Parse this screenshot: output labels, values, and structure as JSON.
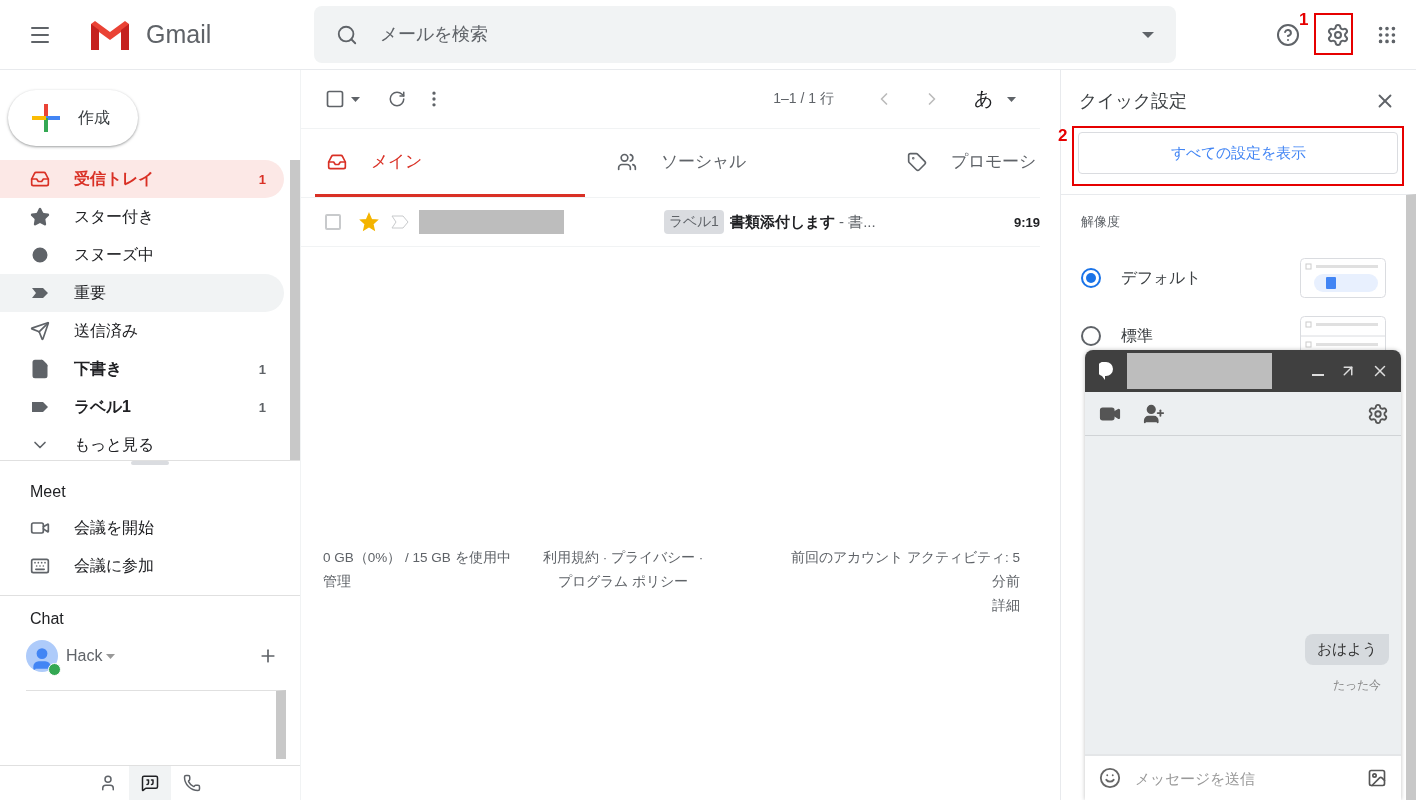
{
  "header": {
    "app_name": "Gmail",
    "search": {
      "placeholder": "メールを検索"
    },
    "settings_annotation": "1"
  },
  "sidebar": {
    "compose": "作成",
    "items": [
      {
        "label": "受信トレイ",
        "count": "1",
        "selected": true,
        "hovered": false,
        "unread": true
      },
      {
        "label": "スター付き",
        "selected": false,
        "hovered": false,
        "unread": false
      },
      {
        "label": "スヌーズ中",
        "selected": false,
        "hovered": false,
        "unread": false
      },
      {
        "label": "重要",
        "selected": false,
        "hovered": true,
        "unread": false
      },
      {
        "label": "送信済み",
        "selected": false,
        "hovered": false,
        "unread": false
      },
      {
        "label": "下書き",
        "count": "1",
        "selected": false,
        "hovered": false,
        "unread": true
      },
      {
        "label": "ラベル1",
        "count": "1",
        "selected": false,
        "hovered": false,
        "unread": true
      },
      {
        "label": "もっと見る",
        "selected": false,
        "hovered": false,
        "unread": false
      }
    ],
    "meet": {
      "title": "Meet",
      "items": [
        {
          "label": "会議を開始"
        },
        {
          "label": "会議に参加"
        }
      ]
    },
    "chat": {
      "title": "Chat",
      "user": "Hack",
      "online": true
    },
    "bottom_tabs": [
      {
        "selected": false
      },
      {
        "selected": true
      },
      {
        "selected": false
      }
    ]
  },
  "toolbar": {
    "select_all_checked": false,
    "page_info": "1–1 / 1 行",
    "input_mode": "あ"
  },
  "tabs": [
    {
      "label": "メイン",
      "selected": true
    },
    {
      "label": "ソーシャル",
      "selected": false
    },
    {
      "label": "プロモーシ",
      "selected": false
    }
  ],
  "emails": [
    {
      "selected": false,
      "starred": true,
      "important": false,
      "label": "ラベル1",
      "subject": "書類添付します",
      "snippet": " - 書...",
      "time": "9:19",
      "unread": true
    }
  ],
  "footer": {
    "storage": "0 GB（0%） / 15 GB を使用中",
    "manage": "管理",
    "links": "利用規約 · プライバシー · プログラム ポリシー",
    "activity": "前回のアカウント アクティビティ: 5 分前",
    "details": "詳細"
  },
  "quick_settings": {
    "title": "クイック設定",
    "all_settings_button": "すべての設定を表示",
    "annotation": "2",
    "section_title": "解像度",
    "density": [
      {
        "label": "デフォルト",
        "kind": "default",
        "selected": true
      },
      {
        "label": "標準",
        "kind": "comfortable",
        "selected": false
      }
    ]
  },
  "chat_window": {
    "messages": [
      {
        "text": "おはよう",
        "time": "たった今"
      }
    ],
    "input": {
      "placeholder": "メッセージを送信"
    }
  }
}
